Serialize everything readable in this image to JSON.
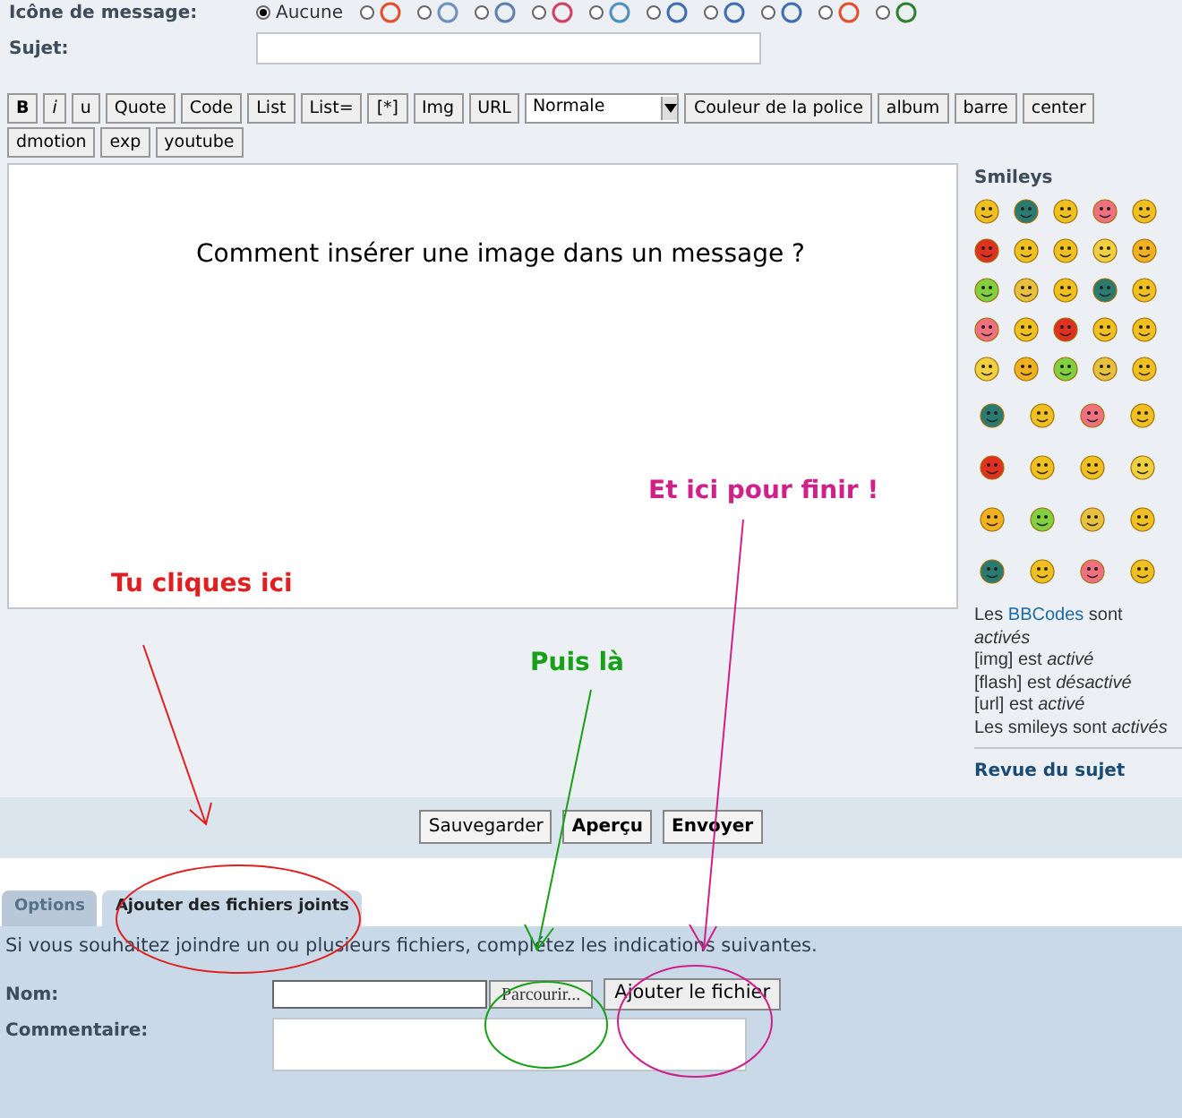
{
  "message_icon": {
    "label": "Icône de message:",
    "options": [
      {
        "label": "Aucune",
        "selected": true
      },
      {
        "selected": false
      },
      {
        "selected": false
      },
      {
        "selected": false
      },
      {
        "selected": false
      },
      {
        "selected": false
      },
      {
        "selected": false
      },
      {
        "selected": false
      },
      {
        "selected": false
      },
      {
        "selected": false
      },
      {
        "selected": false
      }
    ]
  },
  "subject": {
    "label": "Sujet:"
  },
  "toolbar": [
    {
      "kind": "button",
      "label": "B"
    },
    {
      "kind": "button",
      "label": "i"
    },
    {
      "kind": "button",
      "label": "u"
    },
    {
      "kind": "button",
      "label": "Quote"
    },
    {
      "kind": "button",
      "label": "Code"
    },
    {
      "kind": "button",
      "label": "List"
    },
    {
      "kind": "button",
      "label": "List="
    },
    {
      "kind": "button",
      "label": "[*]"
    },
    {
      "kind": "button",
      "label": "Img"
    },
    {
      "kind": "button",
      "label": "URL"
    },
    {
      "kind": "select",
      "label": "Normale"
    },
    {
      "kind": "button",
      "label": "Couleur de la police"
    },
    {
      "kind": "button",
      "label": "album"
    },
    {
      "kind": "button",
      "label": "barre"
    },
    {
      "kind": "button",
      "label": "center"
    },
    {
      "kind": "button",
      "label": "dmotion"
    },
    {
      "kind": "button",
      "label": "exp"
    },
    {
      "kind": "button",
      "label": "youtube"
    }
  ],
  "message_text": "Comment insérer une image dans un message ?",
  "sidebar": {
    "title": "Smileys",
    "bbcodes_note": {
      "prefix": "Les",
      "link": "BBCodes",
      "suffix": "sont",
      "state": "activés"
    },
    "notes": [
      "[img] est *activé*",
      "[flash] est *désactivé*",
      "[url] est *activé*",
      "Les smileys sont *activés*"
    ],
    "review_link": "Revue du sujet"
  },
  "annotations": [
    {
      "text": "Tu cliques ici",
      "color": "#e02020"
    },
    {
      "text": "Puis là",
      "color": "#18a018"
    },
    {
      "text": "Et ici pour finir !",
      "color": "#d0208a"
    }
  ],
  "actions": [
    "Sauvegarder",
    "Aperçu",
    "Envoyer"
  ],
  "tabs": [
    {
      "label": "Options",
      "selected": false
    },
    {
      "label": "Ajouter des fichiers joints",
      "selected": true
    }
  ],
  "attachments": {
    "intro": "Si vous souhaitez joindre un ou plusieurs fichiers, complétez les indications suivantes.",
    "name_label": "Nom:",
    "browse_button": "Parcourir...",
    "add_button": "Ajouter le fichier",
    "comment_label": "Commentaire:"
  }
}
